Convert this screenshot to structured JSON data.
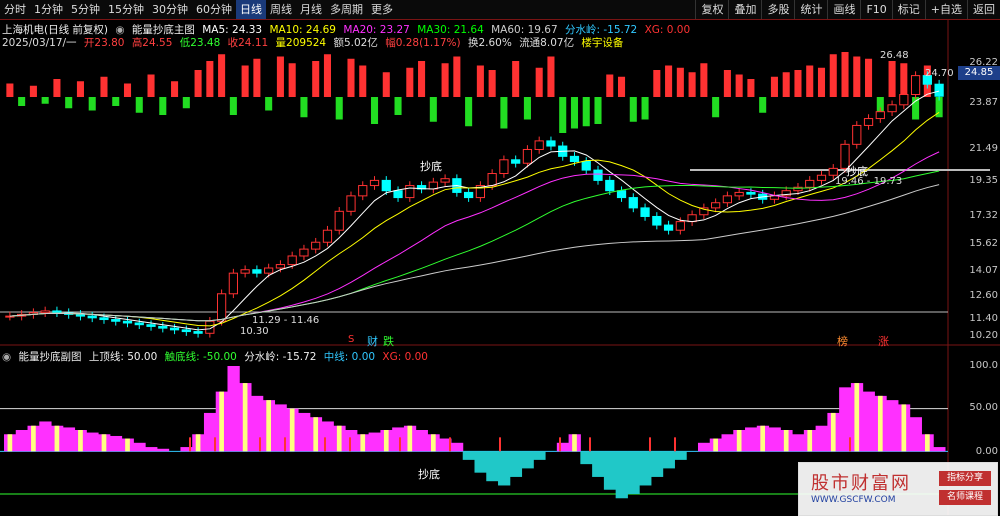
{
  "toolbar": {
    "periods": [
      "分时",
      "1分钟",
      "5分钟",
      "15分钟",
      "30分钟",
      "60分钟",
      "日线",
      "周线",
      "月线",
      "多周期",
      "更多"
    ],
    "active_period": "日线",
    "right_buttons": [
      "复权",
      "叠加",
      "多股",
      "统计",
      "画线",
      "F10",
      "标记",
      "+自选",
      "返回"
    ]
  },
  "main_header": {
    "stock": "上海机电(日线 前复权)",
    "indicator_name": "能量抄底主图",
    "ma5": "MA5: 24.33",
    "ma10": "MA10: 24.69",
    "ma20": "MA20: 23.27",
    "ma30": "MA30: 21.64",
    "ma60": "MA60: 19.67",
    "fsl": "分水岭: -15.72",
    "xg": "XG: 0.00"
  },
  "quote_line": {
    "date": "2025/03/17/一",
    "open": "开23.80",
    "high": "高24.55",
    "low": "低23.48",
    "close": "收24.11",
    "volume": "量209524",
    "amount": "额5.02亿",
    "change": "幅0.28(1.17%)",
    "turnover": "换2.60%",
    "float_value": "流通8.07亿",
    "sector": "楼宇设备"
  },
  "price_axis": [
    "26.22",
    "23.87",
    "21.49",
    "19.35",
    "17.32",
    "15.62",
    "14.07",
    "12.60",
    "11.40",
    "10.20"
  ],
  "current_price_tag": "24.85",
  "annotations": {
    "high_label": "26.48",
    "mid_label": "24.70",
    "low_label": "10.30",
    "range1": "11.29 - 11.46",
    "range2": "19.46 - 19.73",
    "buy_main": "抄底",
    "buy_main2": "抄底",
    "buy_sub": "抄底",
    "sig_cai": "财",
    "sig_die": "跌",
    "sig_s": "S",
    "sig_bang": "榜",
    "sig_zhang": "涨"
  },
  "sub_header": {
    "name": "能量抄底副图",
    "top": "上顶线: 50.00",
    "bottom": "触底线: -50.00",
    "fsl": "分水岭: -15.72",
    "mid": "中线: 0.00",
    "xg": "XG: 0.00"
  },
  "sub_axis": [
    "100.0",
    "50.00",
    "0.00"
  ],
  "watermark": {
    "title": "股市财富网",
    "url": "WWW.GSCFW.COM",
    "tag1": "指标分享",
    "tag2": "名师课程"
  },
  "colors": {
    "up": "#ff3232",
    "down": "#00ffff",
    "green_bar": "#22dd22",
    "magenta": "#ff30ff",
    "cyan_fill": "#20c8c8",
    "yellow": "#ffff80"
  },
  "chart_data": {
    "type": "candlestick",
    "title": "上海机电(日线 前复权)",
    "y_range_main": [
      10.2,
      26.5
    ],
    "y_range_sub": [
      -50,
      100
    ],
    "last_close": 24.11,
    "close_series": [
      11.3,
      11.4,
      11.5,
      11.6,
      11.5,
      11.4,
      11.3,
      11.2,
      11.1,
      11.0,
      10.9,
      10.8,
      10.7,
      10.6,
      10.5,
      10.4,
      10.3,
      11.0,
      12.6,
      13.8,
      14.0,
      13.8,
      14.1,
      14.3,
      14.8,
      15.2,
      15.6,
      16.3,
      17.4,
      18.3,
      18.9,
      19.2,
      18.6,
      18.2,
      18.9,
      18.7,
      19.1,
      19.3,
      18.5,
      18.2,
      18.9,
      19.6,
      20.4,
      20.2,
      21.0,
      21.5,
      21.2,
      20.6,
      20.3,
      19.8,
      19.2,
      18.6,
      18.2,
      17.6,
      17.1,
      16.6,
      16.3,
      16.8,
      17.2,
      17.6,
      17.9,
      18.3,
      18.5,
      18.4,
      18.1,
      18.3,
      18.6,
      18.8,
      19.2,
      19.5,
      19.9,
      21.3,
      22.4,
      22.8,
      23.2,
      23.6,
      24.2,
      25.3,
      24.8,
      24.1
    ],
    "volume_series": [
      30,
      -20,
      25,
      -15,
      40,
      -25,
      35,
      -30,
      45,
      -20,
      30,
      -35,
      50,
      -40,
      35,
      -25,
      60,
      80,
      95,
      -40,
      70,
      85,
      -30,
      90,
      75,
      -45,
      80,
      95,
      -50,
      85,
      70,
      -60,
      55,
      -40,
      65,
      80,
      -55,
      75,
      90,
      -65,
      70,
      60,
      -70,
      80,
      -50,
      65,
      90,
      -80,
      -70,
      -65,
      -60,
      50,
      45,
      -55,
      -50,
      60,
      70,
      65,
      55,
      75,
      -45,
      60,
      50,
      40,
      -35,
      45,
      55,
      60,
      70,
      65,
      95,
      100,
      90,
      85,
      -40,
      80,
      75,
      -50,
      70,
      -45
    ],
    "sub_series": [
      20,
      25,
      30,
      35,
      30,
      28,
      25,
      22,
      20,
      18,
      15,
      10,
      5,
      3,
      0,
      5,
      20,
      45,
      70,
      100,
      80,
      65,
      60,
      55,
      50,
      45,
      40,
      35,
      30,
      25,
      20,
      22,
      25,
      28,
      30,
      25,
      20,
      15,
      10,
      -10,
      -25,
      -35,
      -40,
      -30,
      -20,
      -10,
      0,
      10,
      20,
      -15,
      -30,
      -45,
      -55,
      -50,
      -40,
      -30,
      -20,
      -10,
      0,
      10,
      15,
      20,
      25,
      28,
      30,
      28,
      25,
      20,
      25,
      30,
      45,
      75,
      80,
      70,
      65,
      60,
      55,
      40,
      20,
      5
    ]
  }
}
